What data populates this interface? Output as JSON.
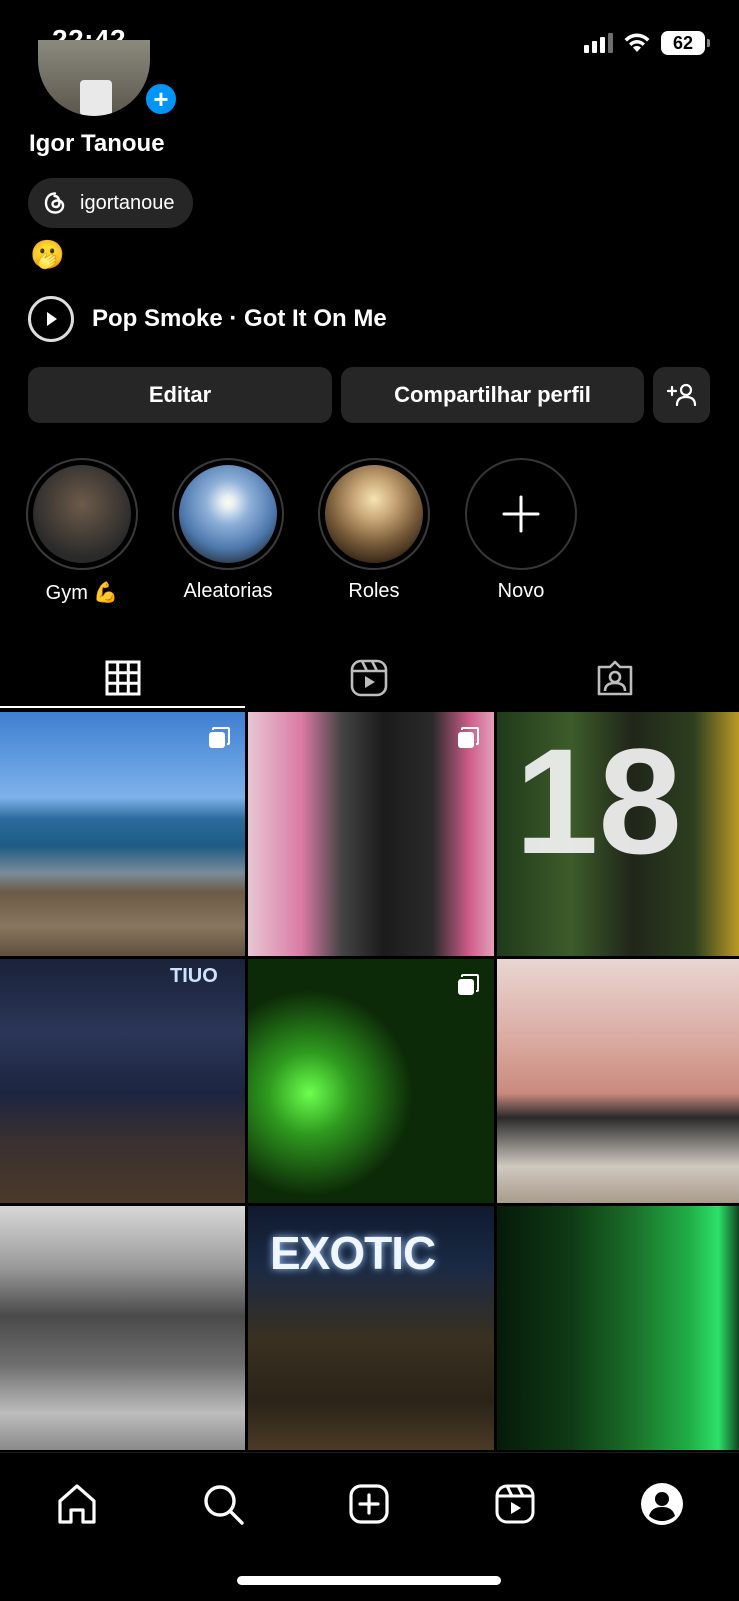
{
  "status_bar": {
    "time": "22:42",
    "battery": "62"
  },
  "profile": {
    "name": "Igor Tanoue",
    "threads_handle": "igortanoue",
    "bio_emoji": "🫢",
    "music": "Pop Smoke · Got It On Me"
  },
  "actions": {
    "edit_label": "Editar",
    "share_label": "Compartilhar perfil"
  },
  "highlights": [
    {
      "label": "Gym 💪"
    },
    {
      "label": "Aleatorias"
    },
    {
      "label": "Roles"
    },
    {
      "label": "Novo"
    }
  ],
  "tabs": [
    "grid-icon",
    "reels-icon",
    "tagged-icon"
  ],
  "grid_posts": [
    {
      "theme": "beach",
      "multi": true
    },
    {
      "theme": "event-poster",
      "multi": true
    },
    {
      "theme": "party-18",
      "multi": false
    },
    {
      "theme": "gym",
      "multi": false
    },
    {
      "theme": "tractor-green",
      "multi": true
    },
    {
      "theme": "restroom",
      "multi": false
    },
    {
      "theme": "bw-street",
      "multi": false
    },
    {
      "theme": "exotic-sign",
      "multi": false
    },
    {
      "theme": "green-fountain",
      "multi": false
    }
  ],
  "grid_text": {
    "exotic": "EXOTIC",
    "eighteen": "18",
    "tiuo": "TIUO"
  },
  "bottom_nav": [
    "home-icon",
    "search-icon",
    "create-icon",
    "reels-icon",
    "profile-icon"
  ],
  "colors": {
    "accent": "#0095f6",
    "button_bg": "#262626",
    "background": "#000000"
  }
}
